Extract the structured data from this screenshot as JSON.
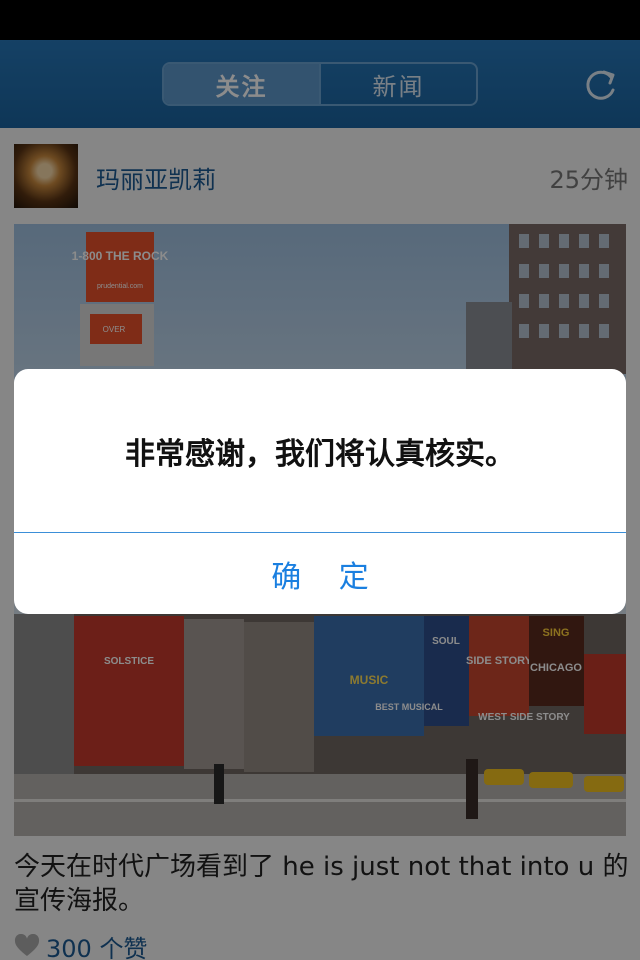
{
  "nav": {
    "tabs": [
      {
        "label": "关注",
        "active": true
      },
      {
        "label": "新闻",
        "active": false
      }
    ],
    "refresh_icon": "refresh-icon"
  },
  "post": {
    "username": "玛丽亚凯莉",
    "time": "25分钟",
    "photo_signs": {
      "billboard": "1-800 THE ROCK",
      "billboard_small": "prudential.com",
      "screen": "OVER",
      "sign_chicago": "CHICAGO",
      "sign_soul": "SOUL",
      "sign_music": "MUSIC",
      "sign_solstice": "SOLSTICE",
      "sign_westside": "WEST SIDE STORY",
      "sign_sing": "SING",
      "sign_side": "SIDE STORY",
      "sign_best": "BEST MUSICAL"
    },
    "caption": "今天在时代广场看到了 he is just not that into u 的宣传海报。",
    "likes": "300 个赞",
    "like_icon": "heart-icon"
  },
  "alert": {
    "message": "非常感谢，我们将认真核实。",
    "button": "确 定"
  },
  "colors": {
    "nav_bg": "#1f6aa8",
    "link": "#1d5a92",
    "alert_button": "#1a7fe0"
  }
}
